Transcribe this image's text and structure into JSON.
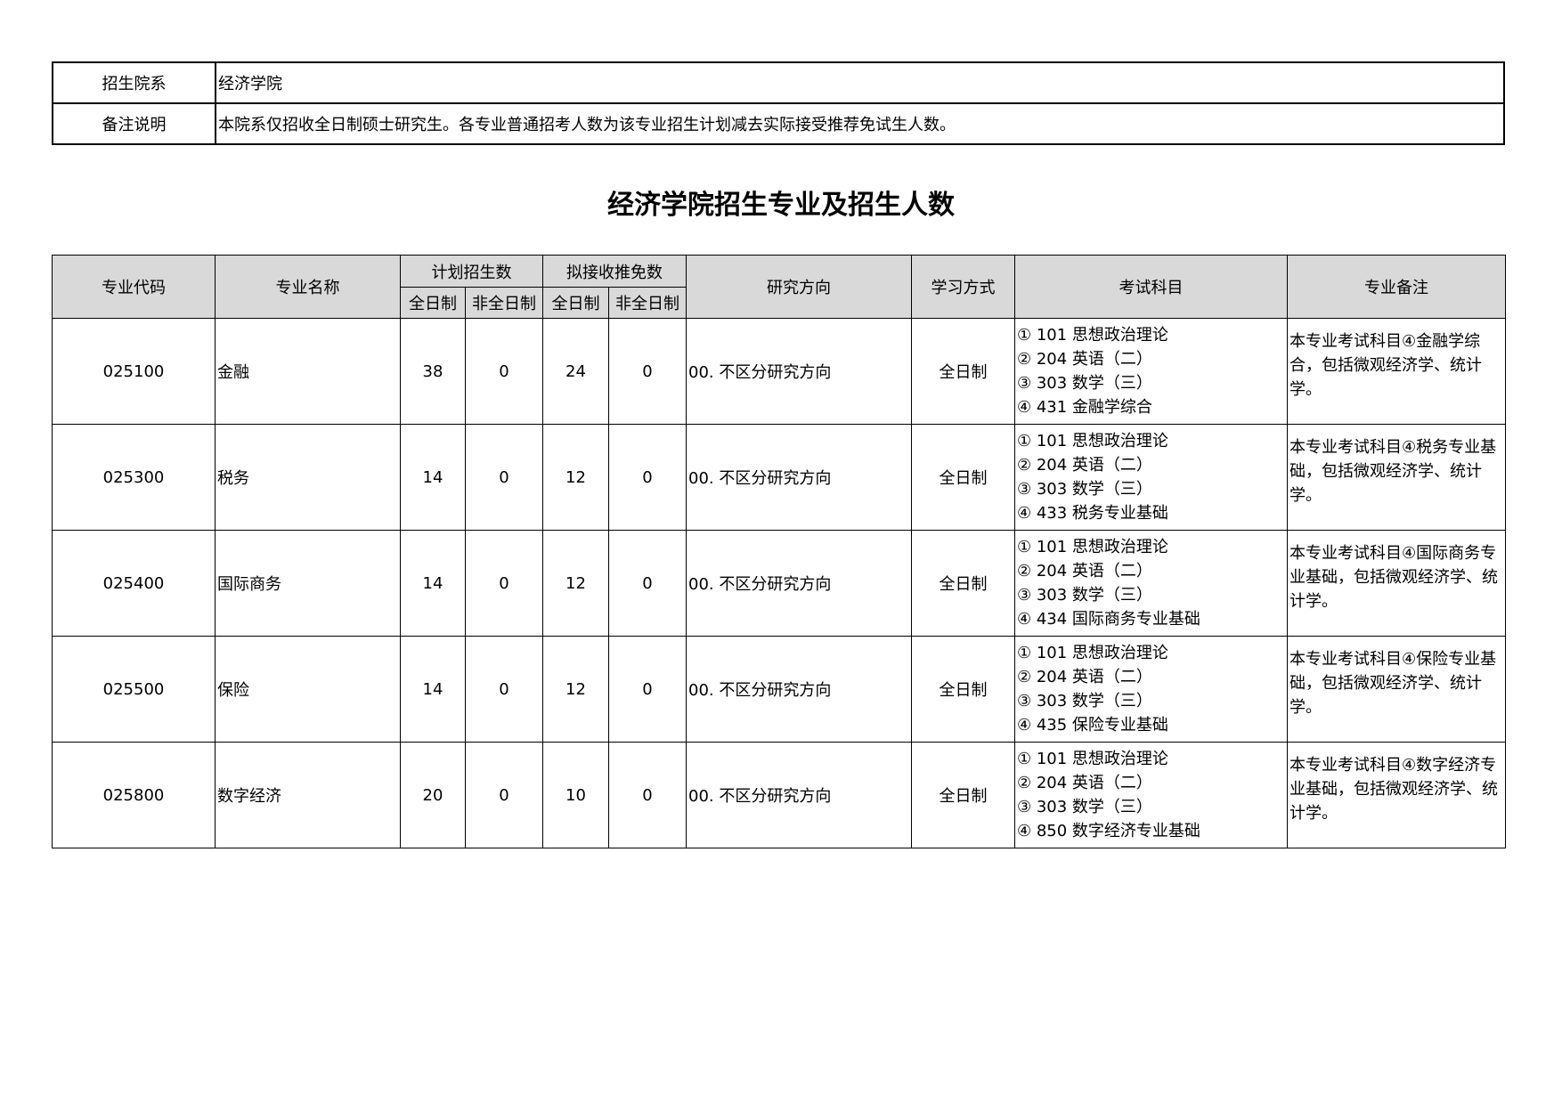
{
  "info": {
    "dept_label": "招生院系",
    "dept_value": "经济学院",
    "remark_label": "备注说明",
    "remark_value": "本院系仅招收全日制硕士研究生。各专业普通招考人数为该专业招生计划减去实际接受推荐免试生人数。"
  },
  "title": "经济学院招生专业及招生人数",
  "headers": {
    "code": "专业代码",
    "name": "专业名称",
    "plan": "计划招生数",
    "recommend": "拟接收推免数",
    "full_time": "全日制",
    "part_time": "非全日制",
    "direction": "研究方向",
    "study_mode": "学习方式",
    "subjects": "考试科目",
    "remark": "专业备注"
  },
  "rows": [
    {
      "code": "025100",
      "name": "金融",
      "plan_full": "38",
      "plan_part": "0",
      "rec_full": "24",
      "rec_part": "0",
      "direction": "00. 不区分研究方向",
      "mode": "全日制",
      "subjects": [
        "① 101 思想政治理论",
        "② 204 英语（二）",
        "③ 303 数学（三）",
        "④ 431 金融学综合"
      ],
      "note": "本专业考试科目④金融学综合，包括微观经济学、统计学。"
    },
    {
      "code": "025300",
      "name": "税务",
      "plan_full": "14",
      "plan_part": "0",
      "rec_full": "12",
      "rec_part": "0",
      "direction": "00. 不区分研究方向",
      "mode": "全日制",
      "subjects": [
        "① 101 思想政治理论",
        "② 204 英语（二）",
        "③ 303 数学（三）",
        "④ 433 税务专业基础"
      ],
      "note": "本专业考试科目④税务专业基础，包括微观经济学、统计学。"
    },
    {
      "code": "025400",
      "name": "国际商务",
      "plan_full": "14",
      "plan_part": "0",
      "rec_full": "12",
      "rec_part": "0",
      "direction": "00. 不区分研究方向",
      "mode": "全日制",
      "subjects": [
        "① 101 思想政治理论",
        "② 204 英语（二）",
        "③ 303 数学（三）",
        "④ 434 国际商务专业基础"
      ],
      "note": "本专业考试科目④国际商务专业基础，包括微观经济学、统计学。"
    },
    {
      "code": "025500",
      "name": "保险",
      "plan_full": "14",
      "plan_part": "0",
      "rec_full": "12",
      "rec_part": "0",
      "direction": "00. 不区分研究方向",
      "mode": "全日制",
      "subjects": [
        "① 101 思想政治理论",
        "② 204 英语（二）",
        "③ 303 数学（三）",
        "④ 435 保险专业基础"
      ],
      "note": "本专业考试科目④保险专业基础，包括微观经济学、统计学。"
    },
    {
      "code": "025800",
      "name": "数字经济",
      "plan_full": "20",
      "plan_part": "0",
      "rec_full": "10",
      "rec_part": "0",
      "direction": "00. 不区分研究方向",
      "mode": "全日制",
      "subjects": [
        "① 101 思想政治理论",
        "② 204 英语（二）",
        "③ 303 数学（三）",
        "④ 850 数字经济专业基础"
      ],
      "note": "本专业考试科目④数字经济专业基础，包括微观经济学、统计学。"
    }
  ]
}
